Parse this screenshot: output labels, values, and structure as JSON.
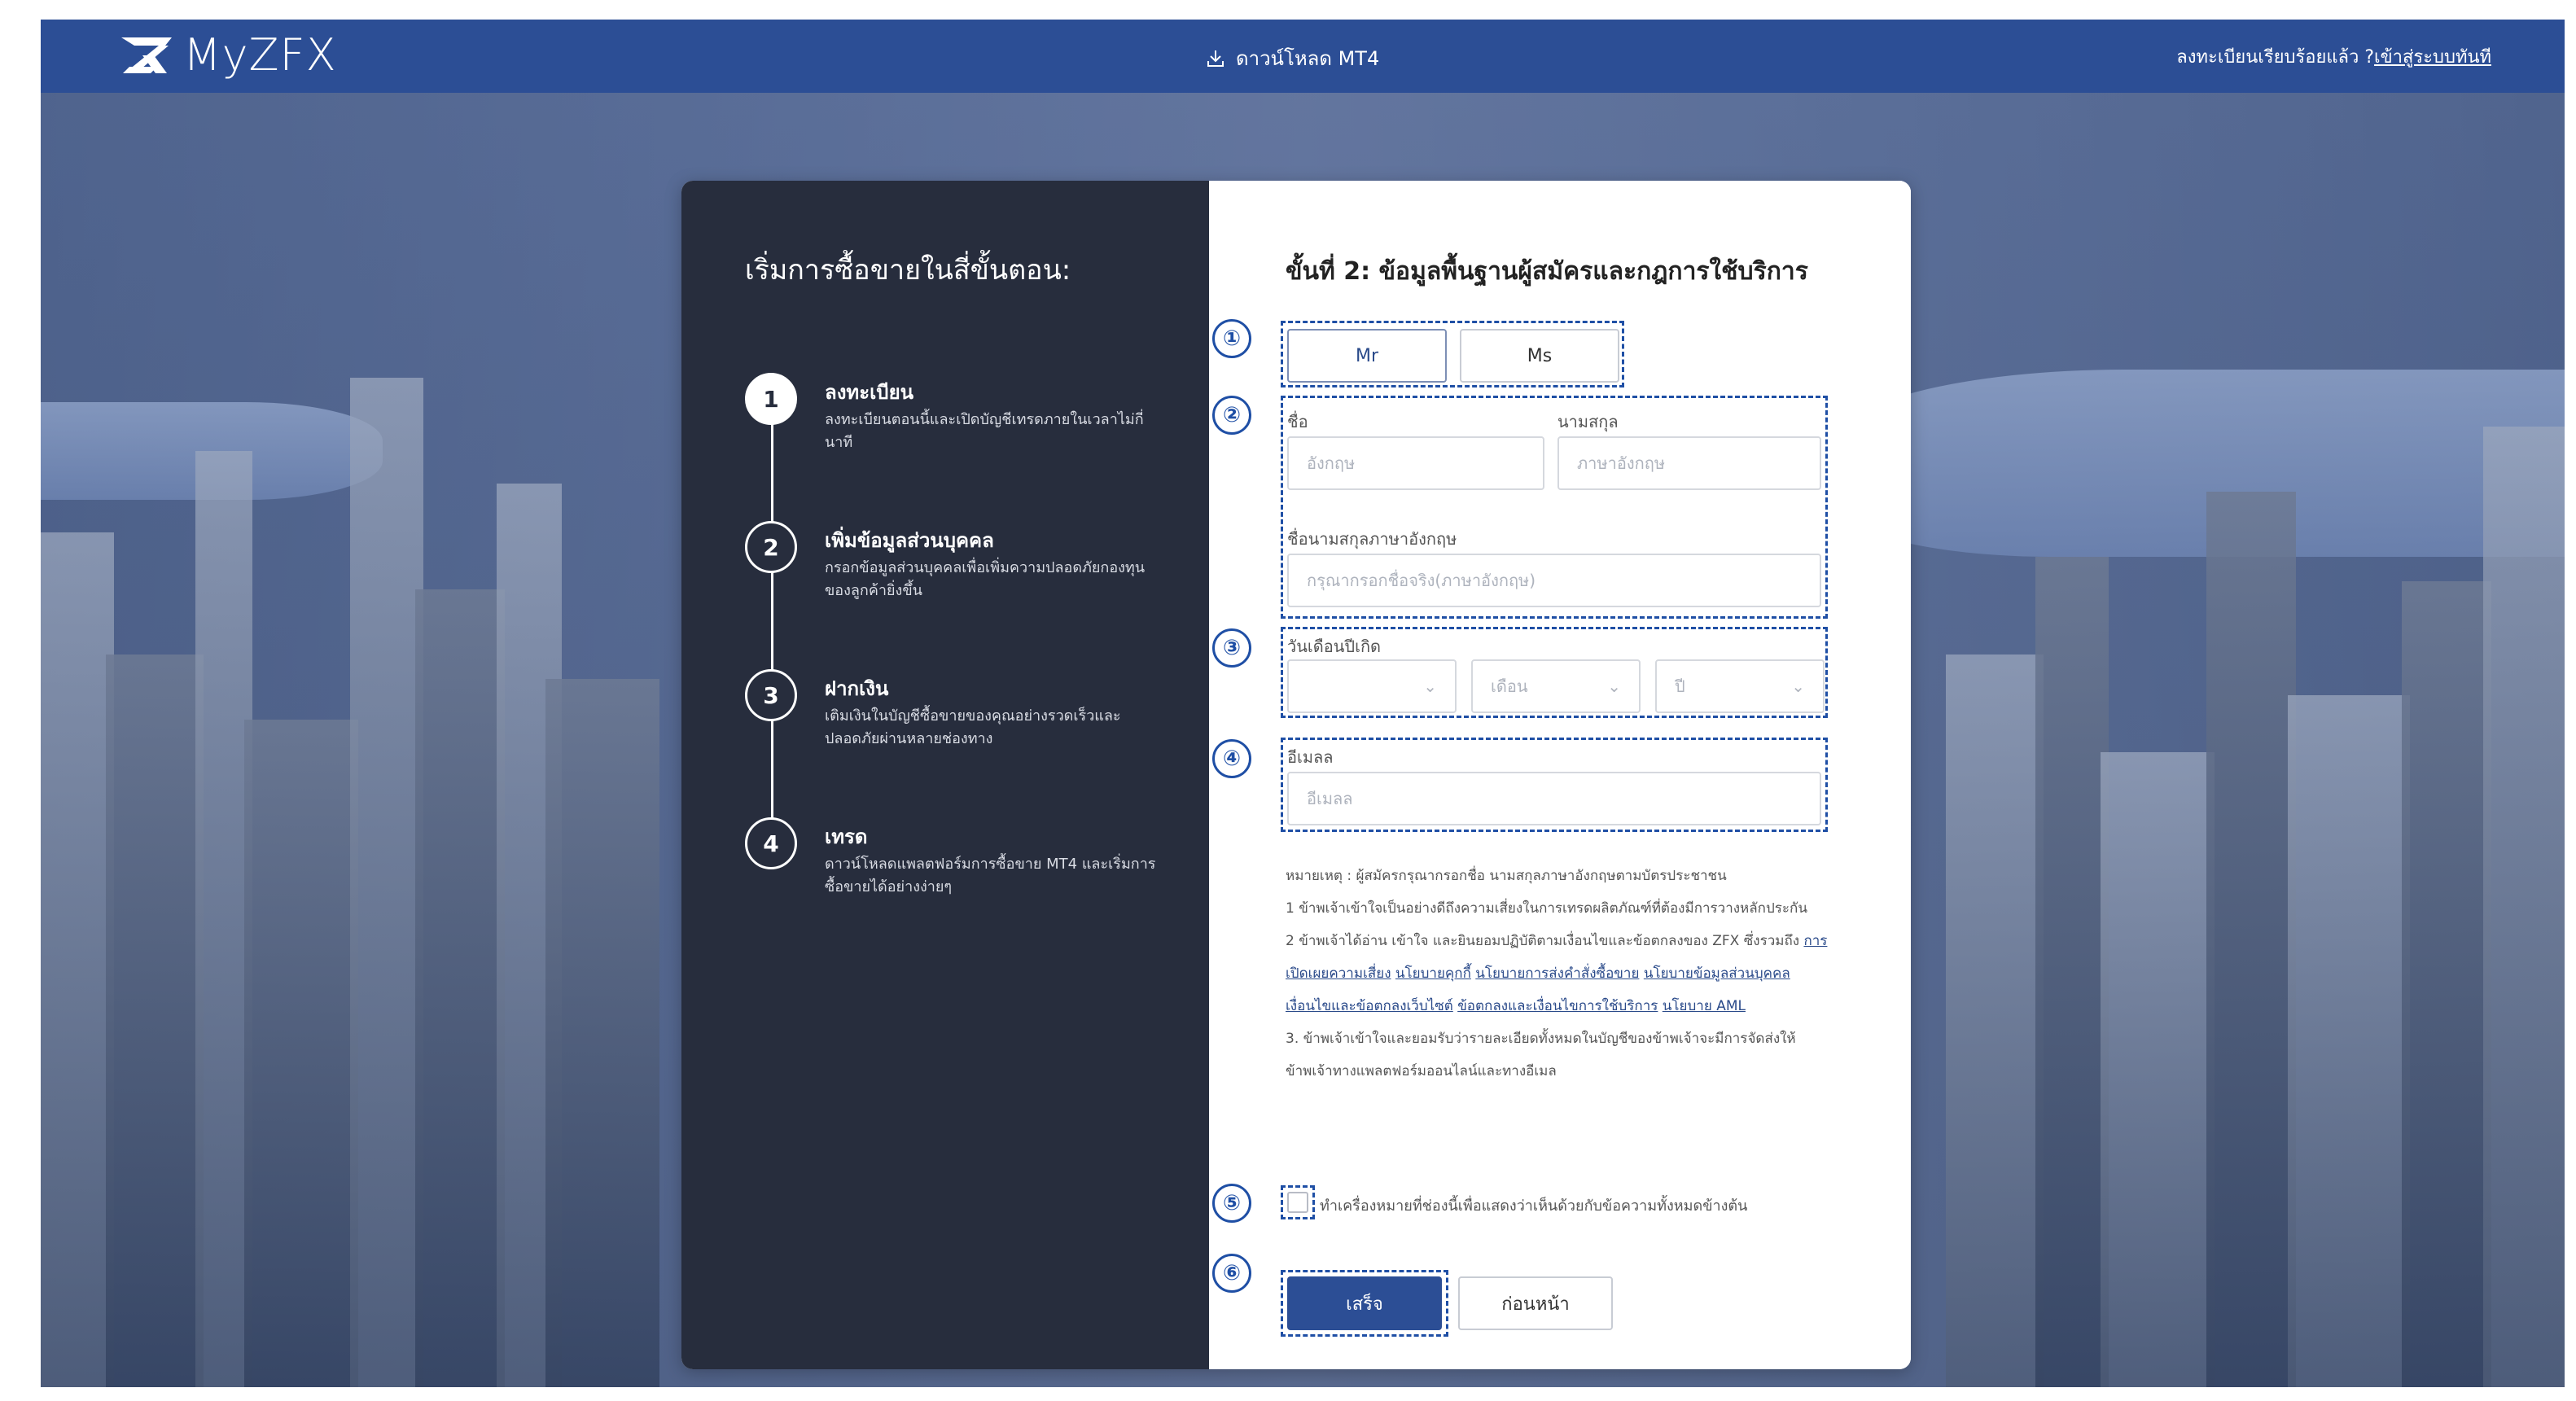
{
  "header": {
    "logo_text": "MyZFX",
    "download_label": "ดาวน์โหลด MT4",
    "login_prompt": "ลงทะเบียนเรียบร้อยแล้ว ?",
    "login_link": "เข้าสู่ระบบทันที"
  },
  "left": {
    "title": "เริ่มการซื้อขายในสี่ขั้นตอน:",
    "steps": [
      {
        "num": "1",
        "title": "ลงทะเบียน",
        "desc": "ลงทะเบียนตอนนี้และเปิดบัญชีเทรดภายในเวลาไม่กี่นาที"
      },
      {
        "num": "2",
        "title": "เพิ่มข้อมูลส่วนบุคคล",
        "desc": "กรอกข้อมูลส่วนบุคคลเพื่อเพิ่มความปลอดภัยกองทุนของลูกค้ายิ่งขึ้น"
      },
      {
        "num": "3",
        "title": "ฝากเงิน",
        "desc": "เติมเงินในบัญชีซื้อขายของคุณอย่างรวดเร็วและปลอดภัยผ่านหลายช่องทาง"
      },
      {
        "num": "4",
        "title": "เทรด",
        "desc": "ดาวน์โหลดแพลตฟอร์มการซื้อขาย MT4 และเริ่มการซื้อขายได้อย่างง่ายๆ"
      }
    ]
  },
  "form": {
    "title": "ขั้นที่ 2: ข้อมูลพื้นฐานผู้สมัครและกฎการใช้บริการ",
    "markers": [
      "①",
      "②",
      "③",
      "④",
      "⑤",
      "⑥"
    ],
    "sex": {
      "mr": "Mr",
      "ms": "Ms"
    },
    "first_name_label": "ชื่อ",
    "first_name_placeholder": "อังกฤษ",
    "last_name_label": "นามสกุล",
    "last_name_placeholder": "ภาษาอังกฤษ",
    "fullname_label": "ชื่อนามสกุลภาษาอังกฤษ",
    "fullname_placeholder": "กรุณากรอกชื่อจริง(ภาษาอังกฤษ)",
    "birth_label": "วันเดือนปีเกิด",
    "day_value": "",
    "month_value": "เดือน",
    "year_value": "ปี",
    "email_label": "อีเมลล",
    "email_placeholder": "อีเมลล",
    "terms": {
      "note": "หมายเหตุ : ผู้สมัครกรุณากรอกชื่อ นามสกุลภาษาอังกฤษตามบัตรประชาชน",
      "item1": "1 ข้าพเจ้าเข้าใจเป็นอย่างดีถึงความเสี่ยงในการเทรดผลิตภัณฑ์ที่ต้องมีการวางหลักประกัน",
      "item2_prefix": "2 ข้าพเจ้าได้อ่าน เข้าใจ และยินยอมปฏิบัติตามเงื่อนไขและข้อตกลงของ ZFX ซึ่งรวมถึง",
      "links": [
        "การเปิดเผยความเสี่ยง",
        "นโยบายคุกกี้",
        "นโยบายการส่งคำสั่งซื้อขาย",
        "นโยบายข้อมูลส่วนบุคคล",
        "เงื่อนไขและข้อตกลงเว็บไซต์",
        "ข้อตกลงและเงื่อนไขการใช้บริการ",
        "นโยบาย AML"
      ],
      "item3": "3. ข้าพเจ้าเข้าใจและยอมรับว่ารายละเอียดทั้งหมดในบัญชีของข้าพเจ้าจะมีการจัดส่งให้ข้าพเจ้าทางแพลตฟอร์มออนไลน์และทางอีเมล"
    },
    "agree_text": "ทำเครื่องหมายที่ช่องนี้เพื่อแสดงว่าเห็นด้วยกับข้อความทั้งหมดข้างต้น",
    "done_label": "เสร็จ",
    "back_label": "ก่อนหน้า"
  },
  "colors": {
    "header": "#2c4e95",
    "panel_dark": "#272d3d",
    "marker_blue": "#1f4fa5"
  }
}
